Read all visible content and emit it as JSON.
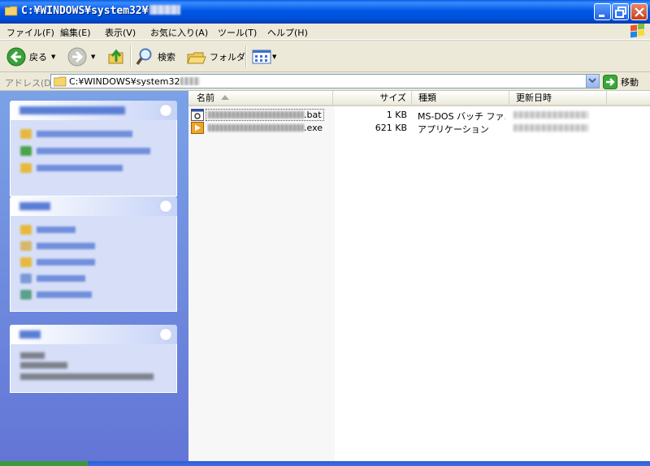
{
  "window": {
    "title": "C:¥WINDOWS¥system32¥"
  },
  "menu": [
    {
      "label": "ファイル(F)"
    },
    {
      "label": "編集(E)"
    },
    {
      "label": "表示(V)"
    },
    {
      "label": "お気に入り(A)"
    },
    {
      "label": "ツール(T)"
    },
    {
      "label": "ヘルプ(H)"
    }
  ],
  "toolbar": {
    "back_label": "戻る",
    "search_label": "検索",
    "folders_label": "フォルダ"
  },
  "address": {
    "label": "アドレス(D)",
    "value": "C:¥WINDOWS¥system32",
    "go_label": "移動"
  },
  "columns": {
    "name": "名前",
    "size": "サイズ",
    "type": "種類",
    "modified": "更新日時"
  },
  "files": [
    {
      "name_suffix": ".bat",
      "size": "1 KB",
      "type": "MS-DOS バッチ ファ..."
    },
    {
      "name_suffix": ".exe",
      "size": "621 KB",
      "type": "アプリケーション"
    }
  ],
  "colors": {
    "titlebar": "#0058e6",
    "taskpane_top": "#7ba2e7",
    "taskpane_bottom": "#6375d6",
    "chrome": "#ece9d8"
  },
  "icons": {
    "title": "folder-icon",
    "back": "back-arrow-icon",
    "forward": "forward-arrow-icon",
    "up": "up-folder-icon",
    "search": "search-magnifier-icon",
    "folders": "folders-icon",
    "views": "views-icon",
    "go": "go-arrow-icon",
    "bat_file": "batch-file-icon",
    "exe_file": "application-icon"
  }
}
